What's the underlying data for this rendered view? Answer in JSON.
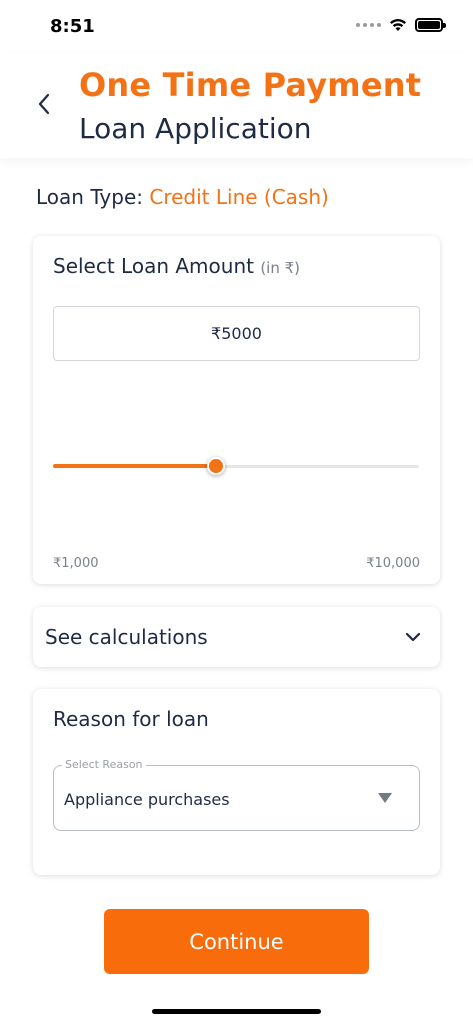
{
  "status": {
    "time": "8:51"
  },
  "header": {
    "title": "One Time Payment",
    "subtitle": "Loan Application"
  },
  "loan_type": {
    "label": "Loan Type: ",
    "value": "Credit Line (Cash)"
  },
  "amount_card": {
    "heading": "Select Loan Amount",
    "unit": "(in ₹)",
    "amount_value": "₹5000",
    "slider": {
      "min": 1000,
      "max": 10000,
      "value": 5000
    },
    "min_label": "₹1,000",
    "max_label": "₹10,000"
  },
  "calculations": {
    "label": "See calculations"
  },
  "reason_card": {
    "heading": "Reason for loan",
    "select_label": "Select Reason",
    "select_value": "Appliance purchases"
  },
  "continue_button": {
    "label": "Continue"
  },
  "colors": {
    "accent": "#f47216",
    "button": "#f96c0c",
    "text": "#1f2a44"
  },
  "icons": {
    "back": "chevron-left-icon",
    "wifi": "wifi-icon",
    "battery": "battery-icon",
    "expand": "chevron-down-icon",
    "dropdown": "caret-down-icon"
  }
}
